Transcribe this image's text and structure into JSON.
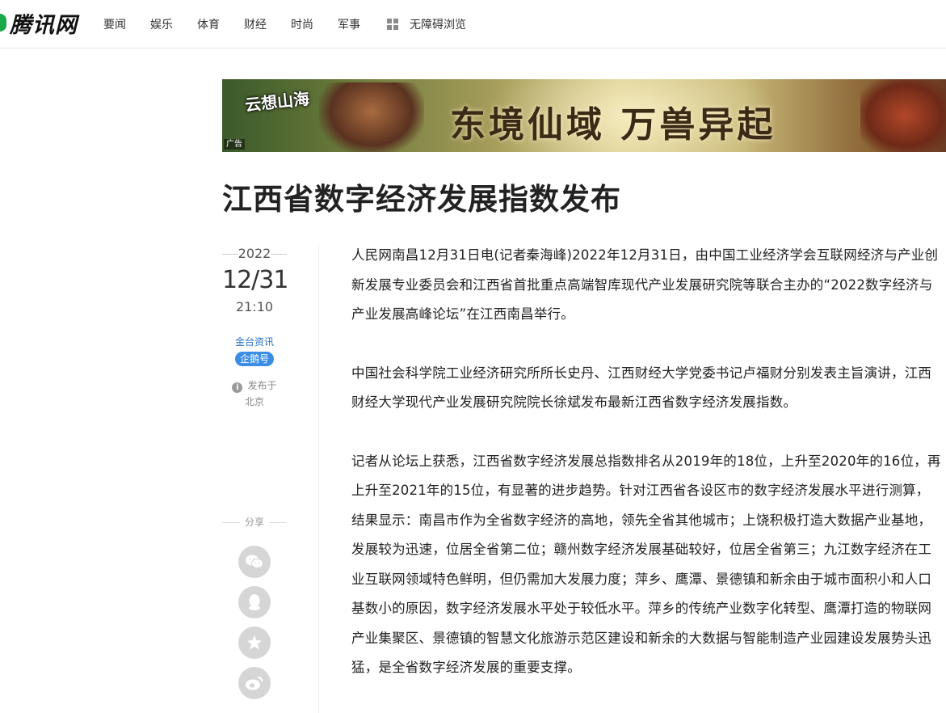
{
  "header": {
    "logo_text": "腾讯网",
    "nav": [
      "要闻",
      "娱乐",
      "体育",
      "财经",
      "时尚",
      "军事"
    ],
    "accessibility": "无障碍浏览"
  },
  "ad": {
    "game_logo": "云想山海",
    "slogan": "东境仙域 万兽异起",
    "label": "广告"
  },
  "article": {
    "title": "江西省数字经济发展指数发布",
    "year": "2022",
    "month_day": "12/31",
    "time": "21:10",
    "source": "金台资讯",
    "source_badge": "企鹅号",
    "published_in": "发布于",
    "location": "北京",
    "paragraphs": [
      "人民网南昌12月31日电(记者秦海峰)2022年12月31日，由中国工业经济学会互联网经济与产业创新发展专业委员会和江西省首批重点高端智库现代产业发展研究院等联合主办的“2022数字经济与产业发展高峰论坛”在江西南昌举行。",
      "中国社会科学院工业经济研究所所长史丹、江西财经大学党委书记卢福财分别发表主旨演讲，江西财经大学现代产业发展研究院院长徐斌发布最新江西省数字经济发展指数。",
      "记者从论坛上获悉，江西省数字经济发展总指数排名从2019年的18位，上升至2020年的16位，再上升至2021年的15位，有显著的进步趋势。针对江西省各设区市的数字经济发展水平进行测算，结果显示：南昌市作为全省数字经济的高地，领先全省其他城市；上饶积极打造大数据产业基地，发展较为迅速，位居全省第二位；赣州数字经济发展基础较好，位居全省第三；九江数字经济在工业互联网领域特色鲜明，但仍需加大发展力度；萍乡、鹰潭、景德镇和新余由于城市面积小和人口基数小的原因，数字经济发展水平处于较低水平。萍乡的传统产业数字化转型、鹰潭打造的物联网产业集聚区、景德镇的智慧文化旅游示范区建设和新余的大数据与智能制造产业园建设发展势头迅猛，是全省数字经济发展的重要支撑。"
    ]
  },
  "share": {
    "label": "分享",
    "buttons": [
      "wechat-icon",
      "qq-icon",
      "qzone-icon",
      "weibo-icon"
    ]
  },
  "colors": {
    "logo_green": "#19a84a",
    "source_blue": "#2b72c8",
    "badge_blue": "#3a8ee6"
  }
}
